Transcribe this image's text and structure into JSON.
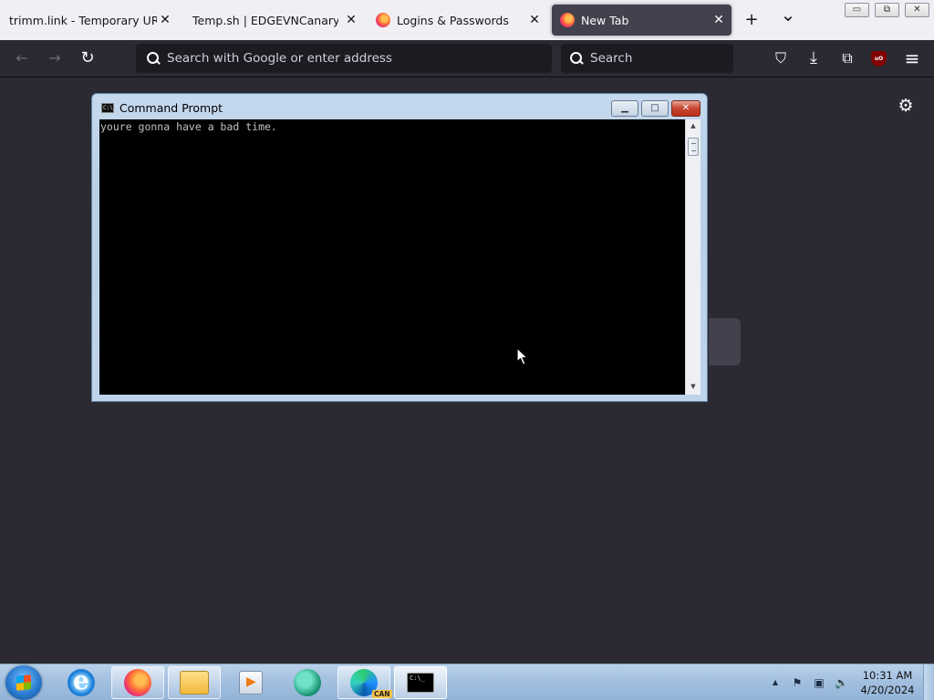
{
  "browser": {
    "tabs": [
      {
        "label": "trimm.link - Temporary URL sh",
        "active": false,
        "has_icon": false
      },
      {
        "label": "Temp.sh | EDGEVNCanary.exe",
        "active": false,
        "has_icon": false
      },
      {
        "label": "Logins & Passwords",
        "active": false,
        "has_icon": true,
        "icon": "firefox-icon"
      },
      {
        "label": "New Tab",
        "active": true,
        "has_icon": true,
        "icon": "firefox-icon"
      }
    ],
    "tab_close_glyph": "✕",
    "new_tab_glyph": "+",
    "list_tabs_glyph": "⌄",
    "window_controls": {
      "minimize": "▭",
      "restore": "⧉",
      "close": "✕"
    },
    "nav": {
      "back_glyph": "←",
      "forward_glyph": "→",
      "reload_glyph": "↻",
      "url_placeholder": "Search with Google or enter address",
      "search_placeholder": "Search",
      "pocket_glyph": "⛉",
      "downloads_glyph": "⤓",
      "extensions_glyph": "⧉",
      "ublock_label": "uO",
      "menu_glyph": "≡"
    },
    "newtab": {
      "settings_glyph": "⚙"
    }
  },
  "cmd_window": {
    "title": "Command Prompt",
    "icon_text": "C:\\",
    "controls": {
      "minimize": "▁",
      "maximize": "□",
      "close": "✕"
    },
    "output": "youre gonna have a bad time."
  },
  "taskbar": {
    "items": [
      "ie-icon",
      "firefox-icon",
      "file-explorer-icon",
      "media-player-icon",
      "app-icon",
      "edge-canary-icon",
      "cmd-icon"
    ],
    "edge_badge": "CAN",
    "cmd_icon_text": "C:\\_",
    "tray": {
      "show_hidden": "▲",
      "flag": "⚑",
      "network": "▣",
      "volume": "🔈"
    },
    "clock": {
      "time": "10:31 AM",
      "date": "4/20/2024"
    }
  },
  "colors": {
    "browser_bg": "#2b2a33",
    "tabstrip_bg": "#f0f0f4",
    "active_tab": "#42414d",
    "urlbar": "#1c1b22",
    "console_bg": "#000000",
    "console_text": "#c0c0c0",
    "taskbar": "#a2bfdf"
  }
}
